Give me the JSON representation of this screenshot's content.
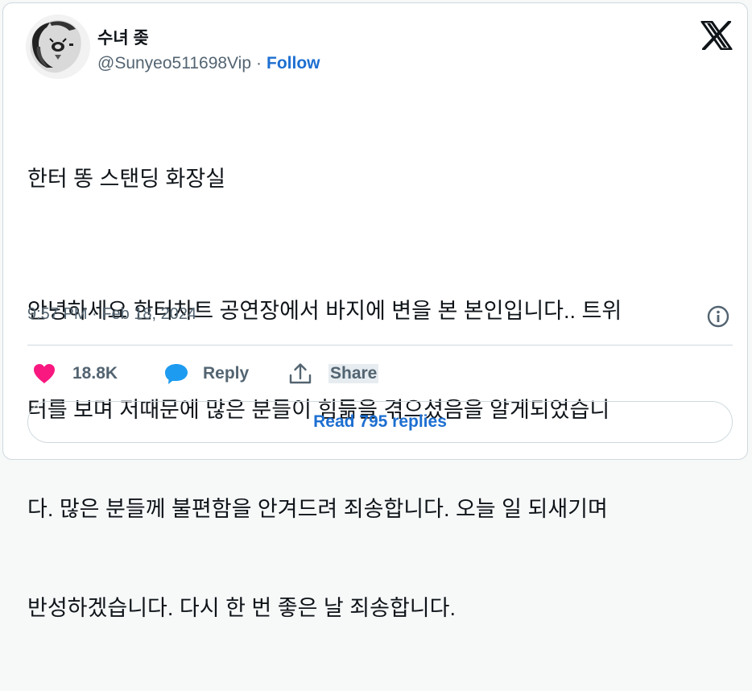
{
  "author": {
    "display_name": "수녀 좆",
    "handle": "@Sunyeo511698Vip",
    "separator": "·",
    "follow_label": "Follow"
  },
  "tweet": {
    "title_line": "한터 똥 스탠딩 화장실",
    "body_lines": [
      "안녕하세요 한터차트 공연장에서 바지에 변을 본 본인입니다.. 트위",
      "터를 보며 저때문에 많은 분들이 힘듦을 겪으셨음을 알게되었습니",
      "다. 많은 분들께 불편함을 안겨드려 죄송합니다. 오늘 일 되새기며",
      "반성하겠습니다. 다시 한 번 좋은 날 죄송합니다."
    ],
    "timestamp": "9:57 PM · Feb 18, 2024"
  },
  "actions": {
    "like_count": "18.8K",
    "reply_label": "Reply",
    "share_label": "Share"
  },
  "read_replies_label": "Read 795 replies",
  "icons": {
    "logo": "x-logo-icon",
    "info": "info-icon",
    "like": "heart-icon",
    "reply": "speech-bubble-icon",
    "share": "share-upload-icon"
  },
  "colors": {
    "link_blue": "#1d6fd1",
    "like_pink": "#f91880",
    "reply_blue": "#1d9bf0",
    "text_primary": "#0f1419",
    "text_secondary": "#536471"
  }
}
